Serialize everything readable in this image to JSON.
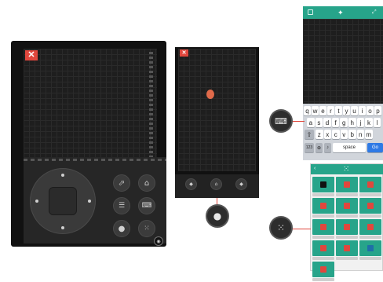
{
  "remote": {
    "close_glyph": "✕",
    "controls": [
      "share",
      "home",
      "menu",
      "keyboard",
      "mouse",
      "apps",
      "touchpad"
    ]
  },
  "mouse_panel": {
    "close_glyph": "✕",
    "buttons": [
      "back",
      "home",
      "forward"
    ],
    "pointer_color": "#e06a4a"
  },
  "keyboard_panel": {
    "rows": [
      [
        "q",
        "w",
        "e",
        "r",
        "t",
        "y",
        "u",
        "i",
        "o",
        "p"
      ],
      [
        "a",
        "s",
        "d",
        "f",
        "g",
        "h",
        "j",
        "k",
        "l"
      ],
      [
        "z",
        "x",
        "c",
        "v",
        "b",
        "n",
        "m"
      ]
    ],
    "num_key": "123",
    "space_label": "space",
    "go_label": "Go"
  },
  "apps_panel": {
    "tile_count": 13
  },
  "colors": {
    "accent": "#27a48a",
    "close_red": "#e0473d",
    "go_blue": "#2f7ae5",
    "tablet_frame": "#111111"
  }
}
